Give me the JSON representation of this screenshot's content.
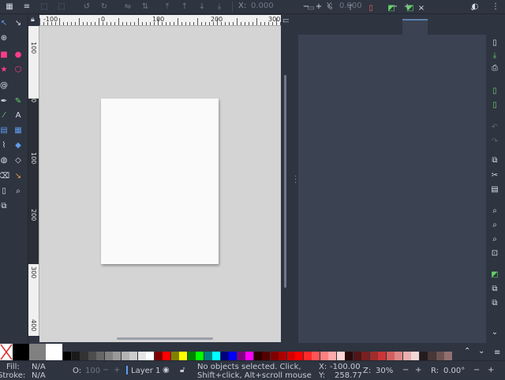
{
  "toolbar": {
    "x_label": "X:",
    "x_value": "0.000",
    "y_label": "Y:",
    "y_value": "0.000",
    "minus": "−",
    "plus": "+"
  },
  "rulers": {
    "h_ticks": [
      "-100",
      "0",
      "100",
      "200",
      "300"
    ],
    "v_ticks": [
      "100",
      "0",
      "100",
      "200",
      "300",
      "400"
    ]
  },
  "dock": {
    "tabs": [
      "fill-stroke-icon",
      "brush-icon",
      "text-icon",
      "align-icon",
      "layers-icon",
      "objects-icon"
    ],
    "close": "×",
    "menu": "⌄"
  },
  "status": {
    "fill_label": "Fill:",
    "fill_value": "N/A",
    "stroke_label": "Stroke:",
    "stroke_value": "N/A",
    "opacity_label": "O:",
    "opacity_value": "100",
    "layer_name": "Layer 1",
    "message_line1": "No objects selected. Click,",
    "message_line2": "Shift+click, Alt+scroll mouse on to...",
    "x_label": "X:",
    "x_value": "-100.00",
    "y_label": "Y:",
    "y_value": "258.77",
    "zoom_label": "Z:",
    "zoom_value": "30%",
    "rotation_label": "R:",
    "rotation_value": "0.00°",
    "minus": "−",
    "plus": "+"
  },
  "palette": {
    "colors": [
      "#000000",
      "#1a1a1a",
      "#333333",
      "#4d4d4d",
      "#666666",
      "#808080",
      "#999999",
      "#b3b3b3",
      "#cccccc",
      "#e6e6e6",
      "#ffffff",
      "#800000",
      "#ff0000",
      "#808000",
      "#ffff00",
      "#008000",
      "#00ff00",
      "#008080",
      "#00ffff",
      "#000080",
      "#0000ff",
      "#800080",
      "#ff00ff",
      "#2b0000",
      "#550000",
      "#800000",
      "#aa0000",
      "#d40000",
      "#ff0000",
      "#ff2a2a",
      "#ff5555",
      "#ff8080",
      "#ffaaaa",
      "#ffd5d5",
      "#280b0b",
      "#501616",
      "#782121",
      "#a02c2c",
      "#c83737",
      "#d35f5f",
      "#de8787",
      "#e9afaf",
      "#f4d7d7",
      "#241c1c",
      "#483737",
      "#6c5353",
      "#916f6f"
    ]
  }
}
